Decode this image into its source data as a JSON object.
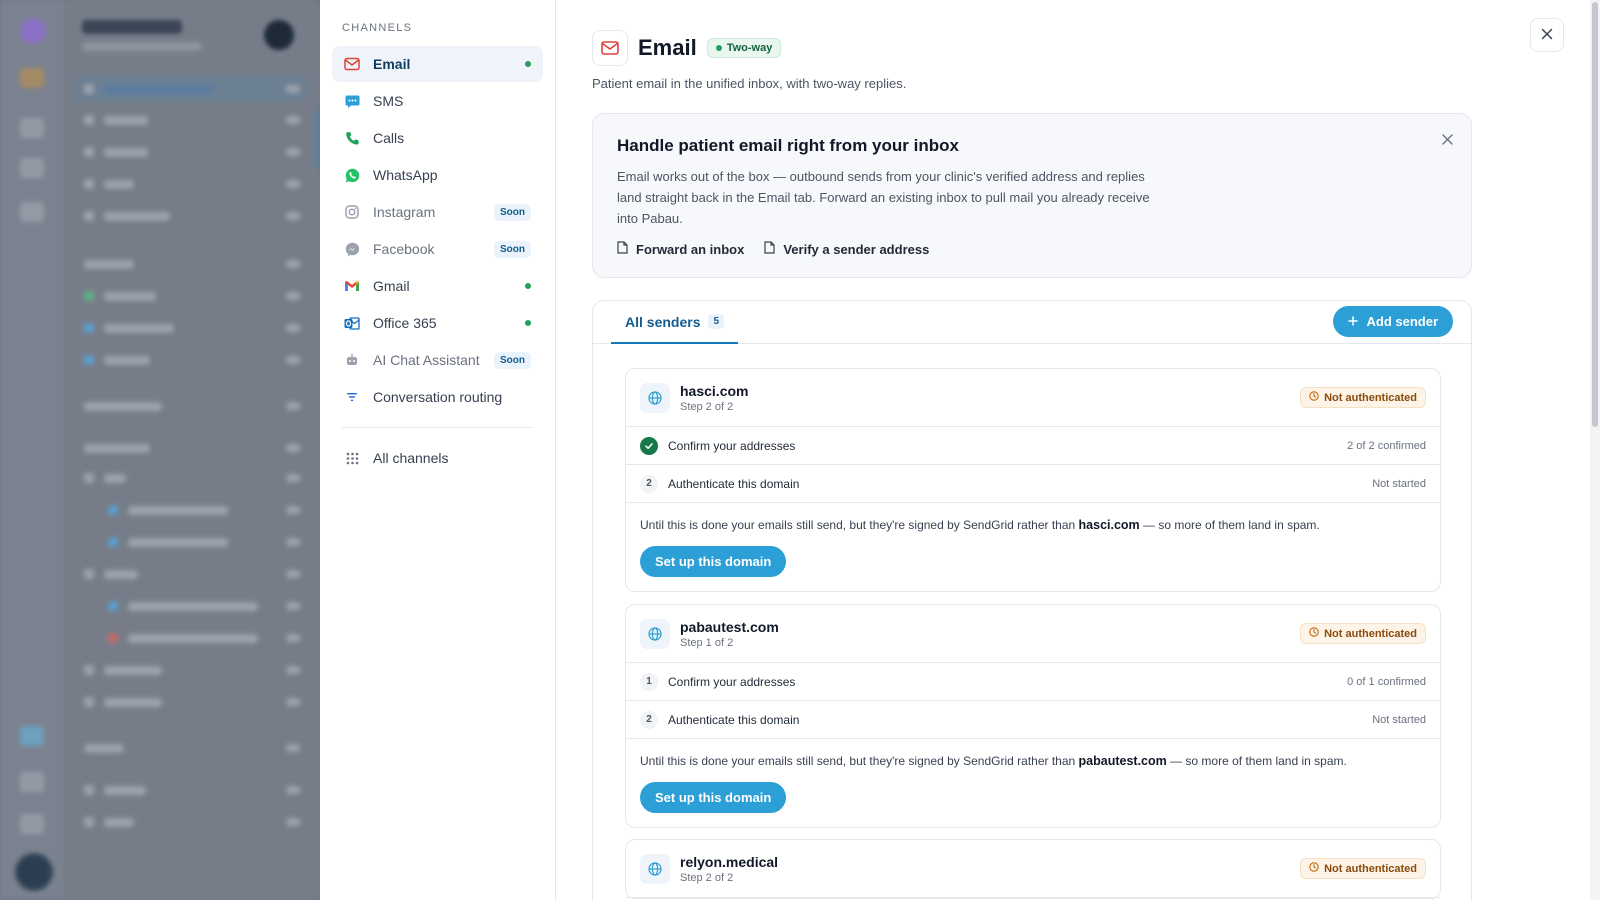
{
  "channels": {
    "section_label": "CHANNELS",
    "items": [
      {
        "label": "Email",
        "status": "connected"
      },
      {
        "label": "SMS"
      },
      {
        "label": "Calls"
      },
      {
        "label": "WhatsApp"
      },
      {
        "label": "Instagram",
        "badge": "Soon"
      },
      {
        "label": "Facebook",
        "badge": "Soon"
      },
      {
        "label": "Gmail",
        "status": "connected"
      },
      {
        "label": "Office 365",
        "status": "connected"
      },
      {
        "label": "AI Chat Assistant",
        "badge": "Soon"
      },
      {
        "label": "Conversation routing"
      }
    ],
    "all_channels": "All channels"
  },
  "header": {
    "title": "Email",
    "badge": "Two-way",
    "subtitle": "Patient email in the unified inbox, with two-way replies."
  },
  "intro": {
    "title": "Handle patient email right from your inbox",
    "body": "Email works out of the box — outbound sends from your clinic's verified address and replies land straight back in the Email tab. Forward an existing inbox to pull mail you already receive into Pabau.",
    "link_forward": "Forward an inbox",
    "link_verify": "Verify a sender address"
  },
  "senders": {
    "tab_label": "All senders",
    "tab_count": "5",
    "add_button": "Add sender",
    "cards": [
      {
        "domain": "hasci.com",
        "step": "Step 2 of 2",
        "status": "Not authenticated",
        "step1_label": "Confirm your addresses",
        "step1_status": "2 of 2 confirmed",
        "step2_num": "2",
        "step2_label": "Authenticate this domain",
        "step2_status": "Not started",
        "note_prefix": "Until this is done your emails still send, but they're signed by SendGrid rather than",
        "note_suffix": "— so more of them land in spam.",
        "button": "Set up this domain"
      },
      {
        "domain": "pabautest.com",
        "step": "Step 1 of 2",
        "status": "Not authenticated",
        "step1_num": "1",
        "step1_label": "Confirm your addresses",
        "step1_status": "0 of 1 confirmed",
        "step2_num": "2",
        "step2_label": "Authenticate this domain",
        "step2_status": "Not started",
        "note_prefix": "Until this is done your emails still send, but they're signed by SendGrid rather than",
        "note_suffix": "— so more of them land in spam.",
        "button": "Set up this domain"
      },
      {
        "domain": "relyon.medical",
        "step": "Step 2 of 2",
        "status": "Not authenticated"
      }
    ]
  },
  "colors": {
    "accent": "#2b9fd6",
    "success": "#22a15c",
    "warning": "#8a4b0f"
  }
}
